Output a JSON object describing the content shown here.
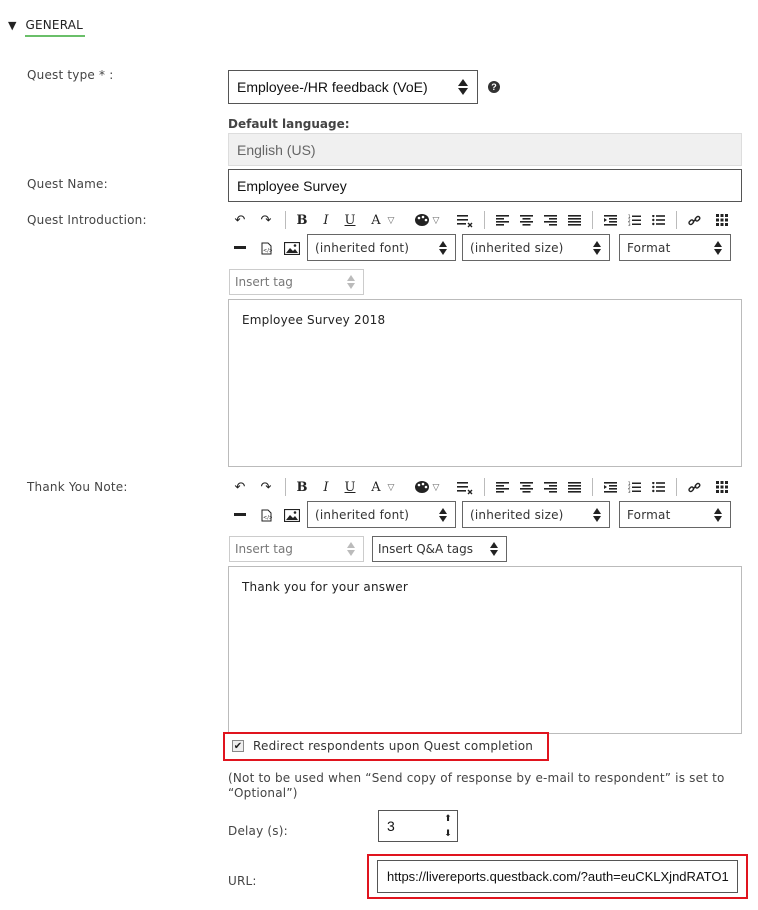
{
  "section": {
    "title": "GENERAL",
    "toggle_icon": "triangle-down-icon"
  },
  "quest_type": {
    "label": "Quest type * :",
    "value": "Employee-/HR feedback (VoE)",
    "help_icon": "?"
  },
  "default_language": {
    "label": "Default language:",
    "value": "English (US)"
  },
  "quest_name": {
    "label": "Quest Name:",
    "value": "Employee Survey"
  },
  "quest_introduction": {
    "label": "Quest Introduction:",
    "font_select": "(inherited font)",
    "size_select": "(inherited size)",
    "format_select": "Format",
    "insert_tag": "Insert tag",
    "content": "Employee Survey 2018"
  },
  "thank_you_note": {
    "label": "Thank You Note:",
    "font_select": "(inherited font)",
    "size_select": "(inherited size)",
    "format_select": "Format",
    "insert_tag": "Insert tag",
    "insert_qa_tags": "Insert Q&A tags",
    "content": "Thank you for your answer"
  },
  "toolbar": {
    "undo": "↶",
    "redo": "↷",
    "bold": "B",
    "italic": "I",
    "underline": "U",
    "font_color": "A",
    "chevron": "▽"
  },
  "redirect": {
    "checked": true,
    "label": "Redirect respondents upon Quest completion",
    "note": "(Not to be used when “Send copy of response by e-mail to respondent” is set to “Optional”)"
  },
  "delay": {
    "label": "Delay (s):",
    "value": "3"
  },
  "url": {
    "label": "URL:",
    "value": "https://livereports.questback.com/?auth=euCKLXjndRATO1"
  },
  "colors": {
    "highlight": "#e0141e",
    "section_underline": "#6abf69"
  }
}
